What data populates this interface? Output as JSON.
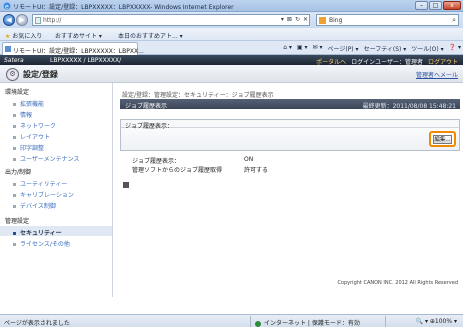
{
  "window": {
    "title": "リモートUI：設定/登録：LBPXXXXX：LBPXXXXX- Windows Internet Explorer",
    "controls": [
      "–",
      "□",
      "x"
    ]
  },
  "navigation": {
    "address": "http://",
    "address_buttons": [
      "▾",
      "⊠",
      "↻",
      "✕"
    ],
    "search_placeholder": "Bing"
  },
  "favorites": {
    "label": "お気に入り",
    "items": [
      "おすすめサイト ▾",
      "本日のおすすめアト... ▾"
    ]
  },
  "tabs": {
    "active_tab": "リモートUI：設定/登録：LBPXXXXX：LBPXX...",
    "commands": [
      "⌂ ▾",
      "▣ ▾",
      "✉ ▾",
      "ページ(P) ▾",
      "セーフティ(S) ▾",
      "ツール(O) ▾",
      "❓ ▾"
    ]
  },
  "app": {
    "brand": "Satera",
    "device": "LBPXXXXX / LBPXXXXX/",
    "header_links": [
      "ポータルへ",
      "ログインユーザー：管理者",
      "ログアウト"
    ],
    "section_icon": "⚙",
    "section_title": "設定/登録",
    "manager_link": "管理者へメール"
  },
  "sidebar": {
    "categories": [
      "環境設定",
      "出力/制御",
      "管理設定"
    ],
    "items_env": [
      "拡張機能",
      "情報",
      "ネットワーク",
      "レイアウト",
      "印字調整",
      "ユーザーメンテナンス"
    ],
    "items_output": [
      "ユーティリティー",
      "キャリブレーション",
      "デバイス制御"
    ],
    "items_admin": [
      "セキュリティー",
      "ライセンス/その他"
    ]
  },
  "main": {
    "breadcrumb": "設定/登録：管理設定：セキュリティー：ジョブ履歴表示",
    "page_title": "ジョブ履歴表示",
    "updated": "最終更新：2011/08/08 15:48:21",
    "panel_title": "ジョブ履歴表示：",
    "edit_button": "編集...",
    "rows": [
      {
        "label": "ジョブ履歴表示：",
        "value": "ON"
      },
      {
        "label": "管理ソフトからのジョブ履歴取得",
        "value": "許可する"
      }
    ],
    "copyright": "Copyright CANON INC. 2012 All Rights Reserved"
  },
  "status": {
    "left": "ページが表示されました",
    "zone": "インターネット | 保護モード：有効",
    "zoom": "🔍 ▾  ⊕100%  ▾"
  },
  "colors": {
    "accent_orange": "#f08a00",
    "header_dark": "#1c2533",
    "link_blue": "#3b6dbf"
  }
}
